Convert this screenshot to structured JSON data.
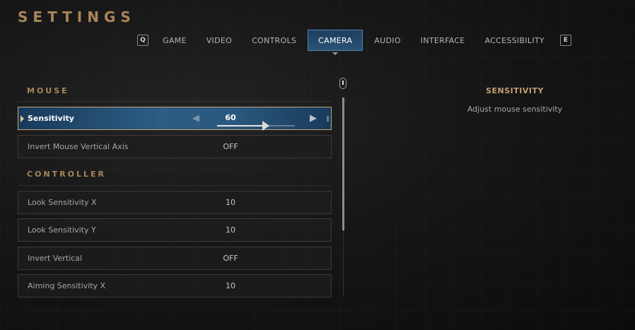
{
  "header": {
    "title": "SETTINGS"
  },
  "tabs": {
    "prev_key": "Q",
    "next_key": "E",
    "items": [
      {
        "label": "GAME"
      },
      {
        "label": "VIDEO"
      },
      {
        "label": "CONTROLS"
      },
      {
        "label": "CAMERA",
        "active": true
      },
      {
        "label": "AUDIO"
      },
      {
        "label": "INTERFACE"
      },
      {
        "label": "ACCESSIBILITY"
      }
    ]
  },
  "sections": {
    "mouse": {
      "title": "MOUSE",
      "sensitivity": {
        "label": "Sensitivity",
        "value": "60",
        "slider_fraction": 0.6
      },
      "invert": {
        "label": "Invert Mouse Vertical Axis",
        "value": "OFF"
      }
    },
    "controller": {
      "title": "CONTROLLER",
      "rows": [
        {
          "label": "Look Sensitivity X",
          "value": "10"
        },
        {
          "label": "Look Sensitivity Y",
          "value": "10"
        },
        {
          "label": "Invert Vertical",
          "value": "OFF"
        },
        {
          "label": "Aiming Sensitivity X",
          "value": "10"
        }
      ]
    }
  },
  "info": {
    "title": "SENSITIVITY",
    "description": "Adjust mouse sensitivity"
  },
  "colors": {
    "accent": "#a9855b",
    "selected_bg": "#2a577d",
    "selected_border": "#c4a478"
  }
}
